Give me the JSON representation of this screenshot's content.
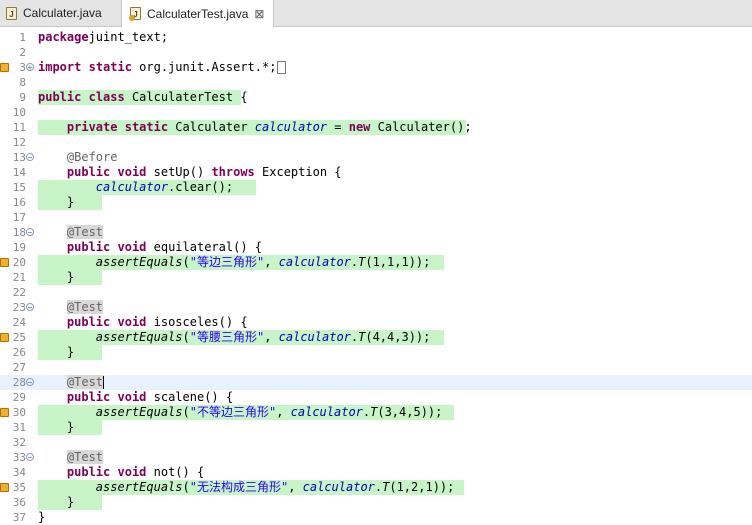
{
  "tabs": [
    {
      "label": "Calculater.java",
      "active": false
    },
    {
      "label": "CalculaterTest.java",
      "active": true,
      "close": "⊠"
    }
  ],
  "colors": {
    "coverage_green": "#c8f5c8",
    "current_line": "#e8f2fe",
    "keyword": "#7f0055",
    "string": "#2a00ff",
    "field": "#0000c0"
  },
  "lines": [
    {
      "n": "1",
      "tokens": [
        [
          "kw",
          "package"
        ],
        [
          "",
          "juint_text;"
        ]
      ]
    },
    {
      "n": "2",
      "tokens": []
    },
    {
      "n": "3",
      "warn": true,
      "fold": "+",
      "tokens": [
        [
          "kw",
          "import"
        ],
        [
          "",
          " "
        ],
        [
          "kw",
          "static"
        ],
        [
          "",
          " org.junit.Assert.*;"
        ]
      ],
      "box": true
    },
    {
      "n": "8",
      "tokens": []
    },
    {
      "n": "9",
      "cov": 1,
      "tokens": [
        [
          "kw",
          "public"
        ],
        [
          "",
          " "
        ],
        [
          "kw",
          "class"
        ],
        [
          "",
          " CalculaterTest {"
        ]
      ]
    },
    {
      "n": "10",
      "tokens": []
    },
    {
      "n": "11",
      "cov": 2,
      "tokens": [
        [
          "",
          "    "
        ],
        [
          "kw",
          "private"
        ],
        [
          "",
          " "
        ],
        [
          "kw",
          "static"
        ],
        [
          "",
          " Calculater "
        ],
        [
          "fld",
          "calculator"
        ],
        [
          "",
          " = "
        ],
        [
          "kw",
          "new"
        ],
        [
          "",
          " Calculater();"
        ]
      ]
    },
    {
      "n": "12",
      "tokens": []
    },
    {
      "n": "13",
      "fold": "-",
      "tokens": [
        [
          "",
          "    "
        ],
        [
          "ann",
          "@Before"
        ]
      ]
    },
    {
      "n": "14",
      "tokens": [
        [
          "",
          "    "
        ],
        [
          "kw",
          "public"
        ],
        [
          "",
          " "
        ],
        [
          "kw",
          "void"
        ],
        [
          "",
          " setUp() "
        ],
        [
          "kw",
          "throws"
        ],
        [
          "",
          " Exception {"
        ]
      ]
    },
    {
      "n": "15",
      "cov": 3,
      "tokens": [
        [
          "",
          "        "
        ],
        [
          "fld",
          "calculator"
        ],
        [
          "",
          ".clear();"
        ]
      ]
    },
    {
      "n": "16",
      "cov": 4,
      "tokens": [
        [
          "",
          "    }"
        ]
      ]
    },
    {
      "n": "17",
      "tokens": []
    },
    {
      "n": "18",
      "fold": "-",
      "tokens": [
        [
          "",
          "    "
        ],
        [
          "annhl",
          "@Test"
        ]
      ]
    },
    {
      "n": "19",
      "tokens": [
        [
          "",
          "    "
        ],
        [
          "kw",
          "public"
        ],
        [
          "",
          " "
        ],
        [
          "kw",
          "void"
        ],
        [
          "",
          " equilateral() {"
        ]
      ]
    },
    {
      "n": "20",
      "warn": true,
      "cov": 5,
      "tokens": [
        [
          "",
          "        "
        ],
        [
          "smeth",
          "assertEquals"
        ],
        [
          "",
          "("
        ],
        [
          "str",
          "\"等边三角形\""
        ],
        [
          "",
          ", "
        ],
        [
          "fld",
          "calculator"
        ],
        [
          "",
          "."
        ],
        [
          "smeth",
          "T"
        ],
        [
          "",
          "(1,1,1));"
        ]
      ]
    },
    {
      "n": "21",
      "cov": 4,
      "tokens": [
        [
          "",
          "    }"
        ]
      ]
    },
    {
      "n": "22",
      "tokens": []
    },
    {
      "n": "23",
      "fold": "-",
      "tokens": [
        [
          "",
          "    "
        ],
        [
          "annhl",
          "@Test"
        ]
      ]
    },
    {
      "n": "24",
      "tokens": [
        [
          "",
          "    "
        ],
        [
          "kw",
          "public"
        ],
        [
          "",
          " "
        ],
        [
          "kw",
          "void"
        ],
        [
          "",
          " isosceles() {"
        ]
      ]
    },
    {
      "n": "25",
      "warn": true,
      "cov": 5,
      "tokens": [
        [
          "",
          "        "
        ],
        [
          "smeth",
          "assertEquals"
        ],
        [
          "",
          "("
        ],
        [
          "str",
          "\"等腰三角形\""
        ],
        [
          "",
          ", "
        ],
        [
          "fld",
          "calculator"
        ],
        [
          "",
          "."
        ],
        [
          "smeth",
          "T"
        ],
        [
          "",
          "(4,4,3));"
        ]
      ]
    },
    {
      "n": "26",
      "cov": 4,
      "tokens": [
        [
          "",
          "    }"
        ]
      ]
    },
    {
      "n": "27",
      "tokens": []
    },
    {
      "n": "28",
      "fold": "-",
      "current": true,
      "tokens": [
        [
          "",
          "    "
        ],
        [
          "annhl",
          "@Test"
        ]
      ],
      "cursor": true
    },
    {
      "n": "29",
      "tokens": [
        [
          "",
          "    "
        ],
        [
          "kw",
          "public"
        ],
        [
          "",
          " "
        ],
        [
          "kw",
          "void"
        ],
        [
          "",
          " scalene() {"
        ]
      ]
    },
    {
      "n": "30",
      "warn": true,
      "cov": 6,
      "tokens": [
        [
          "",
          "        "
        ],
        [
          "smeth",
          "assertEquals"
        ],
        [
          "",
          "("
        ],
        [
          "str",
          "\"不等边三角形\""
        ],
        [
          "",
          ", "
        ],
        [
          "fld",
          "calculator"
        ],
        [
          "",
          "."
        ],
        [
          "smeth",
          "T"
        ],
        [
          "",
          "(3,4,5));"
        ]
      ]
    },
    {
      "n": "31",
      "cov": 4,
      "tokens": [
        [
          "",
          "    }"
        ]
      ]
    },
    {
      "n": "32",
      "tokens": []
    },
    {
      "n": "33",
      "fold": "-",
      "tokens": [
        [
          "",
          "    "
        ],
        [
          "annhl",
          "@Test"
        ]
      ]
    },
    {
      "n": "34",
      "tokens": [
        [
          "",
          "    "
        ],
        [
          "kw",
          "public"
        ],
        [
          "",
          " "
        ],
        [
          "kw",
          "void"
        ],
        [
          "",
          " not() {"
        ]
      ]
    },
    {
      "n": "35",
      "warn": true,
      "cov": 7,
      "tokens": [
        [
          "",
          "        "
        ],
        [
          "smeth",
          "assertEquals"
        ],
        [
          "",
          "("
        ],
        [
          "str",
          "\"无法构成三角形\""
        ],
        [
          "",
          ", "
        ],
        [
          "fld",
          "calculator"
        ],
        [
          "",
          "."
        ],
        [
          "smeth",
          "T"
        ],
        [
          "",
          "(1,2,1));"
        ]
      ]
    },
    {
      "n": "36",
      "cov": 4,
      "tokens": [
        [
          "",
          "    }"
        ]
      ]
    },
    {
      "n": "37",
      "tokens": [
        [
          "",
          "}"
        ]
      ]
    }
  ]
}
